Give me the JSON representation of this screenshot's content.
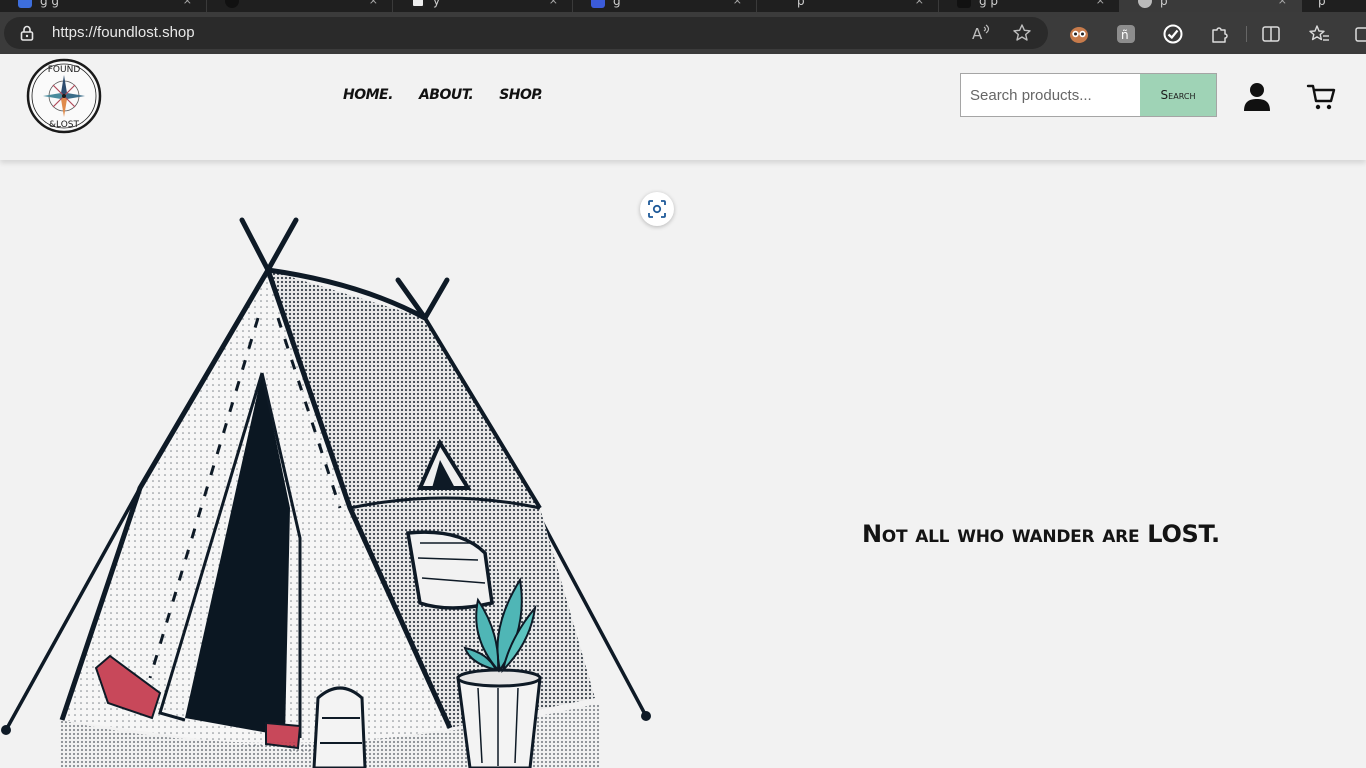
{
  "browser": {
    "tabs": [
      {
        "title": "g   g",
        "close": "×"
      },
      {
        "title": "",
        "close": "×"
      },
      {
        "title": "y",
        "close": "×"
      },
      {
        "title": "g",
        "close": "×"
      },
      {
        "title": "p",
        "close": "×"
      },
      {
        "title": "g  p",
        "close": "×"
      },
      {
        "title": "p",
        "close": "×"
      },
      {
        "title": "p",
        "close": "×"
      }
    ],
    "url": "https://foundlost.shop",
    "icons": {
      "lock": "lock-icon",
      "read_aloud": "read-aloud-icon",
      "favorite": "star-icon",
      "extensions": [
        "owl-extension-icon",
        "translate-extension-icon",
        "check-extension-icon",
        "puzzle-icon",
        "split-screen-icon",
        "favorites-icon",
        "collections-icon"
      ]
    }
  },
  "site": {
    "logo": {
      "top_text": "FOUND",
      "bottom_text": "&LOST"
    },
    "nav": [
      {
        "label": "HOME."
      },
      {
        "label": "ABOUT."
      },
      {
        "label": "SHOP."
      }
    ],
    "search": {
      "placeholder": "Search products...",
      "button_label": "Search"
    },
    "icons": {
      "account": "user-icon",
      "cart": "cart-icon",
      "visual_search": "visual-search-icon"
    },
    "colors": {
      "search_button": "#9fd3b6",
      "page_bg": "#f2f2f2",
      "tent_accent": "#c8485a",
      "plant": "#4fb6b6"
    }
  },
  "hero": {
    "tagline": "Not all who wander are LOST."
  }
}
